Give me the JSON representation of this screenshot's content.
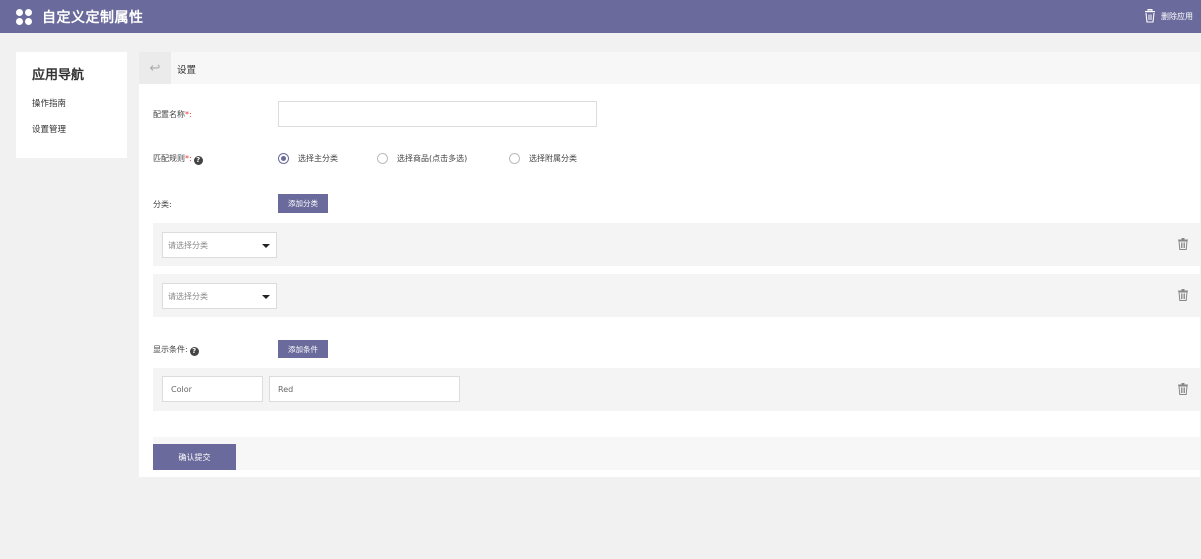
{
  "header": {
    "title": "自定义定制属性",
    "delete_app": "删除应用"
  },
  "sidebar": {
    "title": "应用导航",
    "items": [
      {
        "label": "操作指南"
      },
      {
        "label": "设置管理"
      }
    ]
  },
  "tabbar": {
    "back_symbol": "↩",
    "label": "设置"
  },
  "form": {
    "config_name": {
      "label": "配置名称",
      "required_mark": "*:",
      "value": ""
    },
    "match_rule": {
      "label": "匹配规则",
      "required_mark": "*:",
      "options": [
        {
          "label": "选择主分类",
          "selected": true
        },
        {
          "label": "选择商品(点击多选)",
          "selected": false
        },
        {
          "label": "选择附属分类",
          "selected": false
        }
      ]
    },
    "category": {
      "label": "分类:",
      "add_button": "添加分类",
      "rows": [
        {
          "placeholder": "请选择分类"
        },
        {
          "placeholder": "请选择分类"
        }
      ]
    },
    "display_condition": {
      "label": "显示条件:",
      "add_button": "添加条件",
      "rows": [
        {
          "key": "Color",
          "value": "Red"
        }
      ]
    },
    "submit_button": "确认提交"
  },
  "colors": {
    "accent": "#6a6a9c",
    "required": "#e33333"
  },
  "icons": {
    "logo": "clover-icon",
    "delete": "trash-icon",
    "help": "question-circle-icon",
    "dropdown": "caret-down-icon",
    "back": "undo-icon"
  }
}
